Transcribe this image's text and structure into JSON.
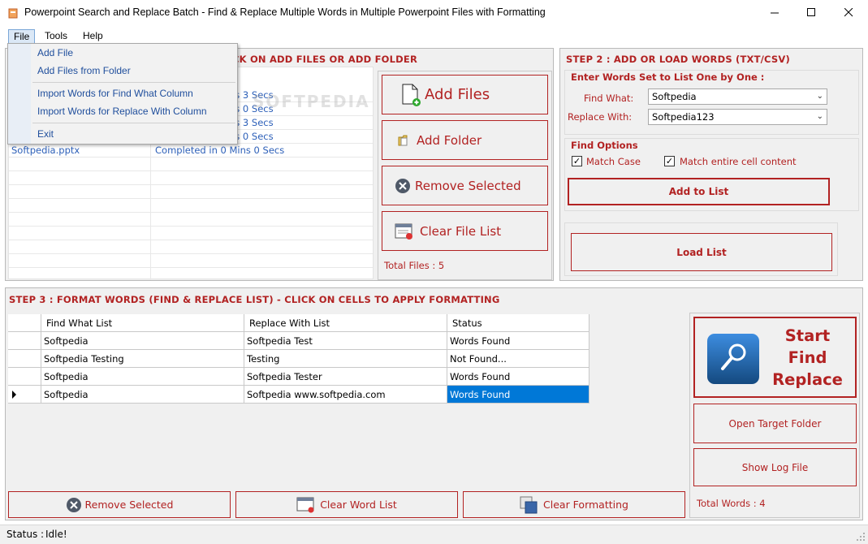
{
  "window": {
    "title": "Powerpoint Search and Replace Batch - Find & Replace Multiple Words in Multiple Powerpoint Files with Formatting"
  },
  "menubar": {
    "file": "File",
    "tools": "Tools",
    "help": "Help"
  },
  "file_menu": {
    "items": [
      "Add File",
      "Add Files from Folder",
      "Import Words for Find What Column",
      "Import Words for Replace With Column",
      "Exit"
    ]
  },
  "step1": {
    "title_visible": "CK ON ADD FILES OR ADD FOLDER",
    "files": [
      {
        "name": "",
        "status": "ns 3 Secs"
      },
      {
        "name": "",
        "status": "ns 0 Secs"
      },
      {
        "name": "",
        "status": "ns 3 Secs"
      },
      {
        "name": "",
        "status": "ns 0 Secs"
      },
      {
        "name": "Softpedia.pptx",
        "status": "Completed in 0 Mins 0 Secs"
      }
    ],
    "watermark": "SOFTPEDIA",
    "buttons": {
      "add_files": "Add Files",
      "add_folder": "Add Folder",
      "remove_selected": "Remove Selected",
      "clear_file_list": "Clear File List"
    },
    "total_files": "Total Files : 5"
  },
  "step2": {
    "title": "STEP 2 : ADD OR LOAD WORDS (TXT/CSV)",
    "enter_title": "Enter Words Set to List One by One :",
    "find_what_label": "Find What:",
    "find_what_value": "Softpedia",
    "replace_with_label": "Replace With:",
    "replace_with_value": "Softpedia123",
    "find_options_title": "Find Options",
    "match_case": "Match Case",
    "match_entire": "Match entire cell content",
    "add_to_list": "Add to List",
    "load_list": "Load List"
  },
  "step3": {
    "title": "STEP 3 : FORMAT WORDS (FIND & REPLACE LIST) - CLICK ON CELLS TO APPLY FORMATTING",
    "columns": [
      "Find What List",
      "Replace With List",
      "Status"
    ],
    "rows": [
      {
        "find": "Softpedia",
        "replace": "Softpedia Test",
        "status": "Words Found"
      },
      {
        "find": "Softpedia Testing",
        "replace": "Testing",
        "status": "Not Found..."
      },
      {
        "find": "Softpedia",
        "replace": "Softpedia Tester",
        "status": "Words Found"
      },
      {
        "find": "Softpedia",
        "replace": "Softpedia www.softpedia.com",
        "status": "Words Found"
      }
    ],
    "buttons": {
      "remove_selected": "Remove Selected",
      "clear_word_list": "Clear Word List",
      "clear_formatting": "Clear Formatting"
    }
  },
  "actions": {
    "start_line1": "Start",
    "start_line2": "Find",
    "start_line3": "Replace",
    "open_target": "Open Target Folder",
    "show_log": "Show Log File",
    "total_words": "Total Words : 4"
  },
  "status": {
    "label": "Status :",
    "value": "Idle!"
  },
  "colors": {
    "accent_red": "#b22222",
    "link_blue": "#2c5fb8",
    "selection": "#0078d7"
  }
}
